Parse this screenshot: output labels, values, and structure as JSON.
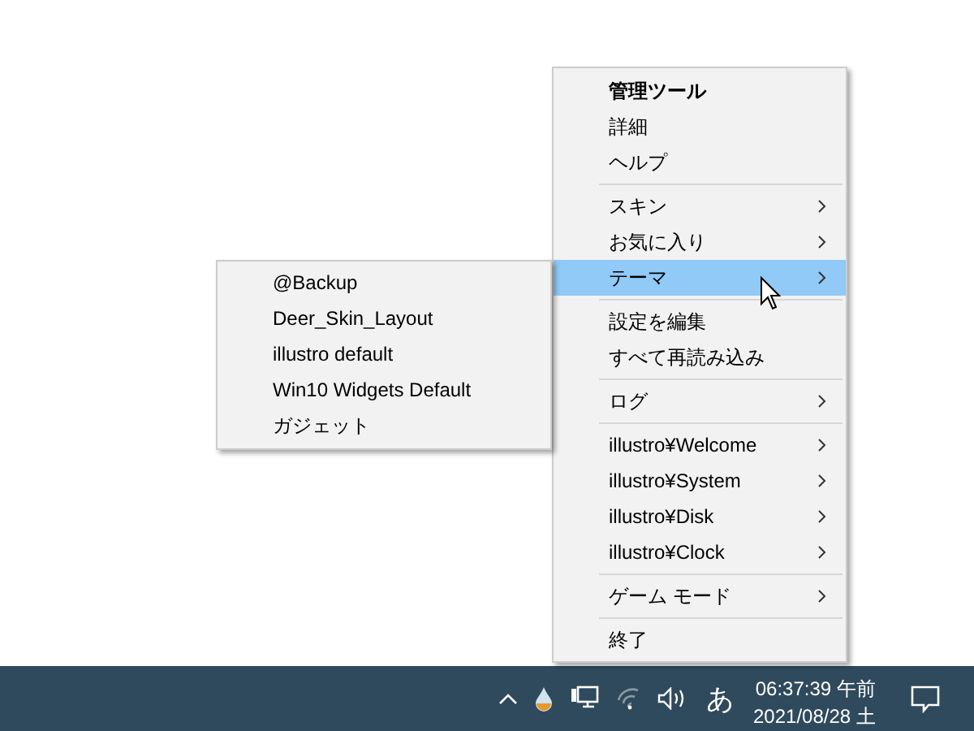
{
  "context_menu": {
    "items": [
      {
        "kind": "item",
        "label": "管理ツール",
        "bold": true,
        "selected": false,
        "has_submenu": false
      },
      {
        "kind": "item",
        "label": "詳細",
        "bold": false,
        "selected": false,
        "has_submenu": false
      },
      {
        "kind": "item",
        "label": "ヘルプ",
        "bold": false,
        "selected": false,
        "has_submenu": false
      },
      {
        "kind": "separator"
      },
      {
        "kind": "item",
        "label": "スキン",
        "bold": false,
        "selected": false,
        "has_submenu": true
      },
      {
        "kind": "item",
        "label": "お気に入り",
        "bold": false,
        "selected": false,
        "has_submenu": true
      },
      {
        "kind": "item",
        "label": "テーマ",
        "bold": false,
        "selected": true,
        "has_submenu": true
      },
      {
        "kind": "separator"
      },
      {
        "kind": "item",
        "label": "設定を編集",
        "bold": false,
        "selected": false,
        "has_submenu": false
      },
      {
        "kind": "item",
        "label": "すべて再読み込み",
        "bold": false,
        "selected": false,
        "has_submenu": false
      },
      {
        "kind": "separator"
      },
      {
        "kind": "item",
        "label": "ログ",
        "bold": false,
        "selected": false,
        "has_submenu": true
      },
      {
        "kind": "separator"
      },
      {
        "kind": "item",
        "label": "illustro¥Welcome",
        "bold": false,
        "selected": false,
        "has_submenu": true
      },
      {
        "kind": "item",
        "label": "illustro¥System",
        "bold": false,
        "selected": false,
        "has_submenu": true
      },
      {
        "kind": "item",
        "label": "illustro¥Disk",
        "bold": false,
        "selected": false,
        "has_submenu": true
      },
      {
        "kind": "item",
        "label": "illustro¥Clock",
        "bold": false,
        "selected": false,
        "has_submenu": true
      },
      {
        "kind": "separator"
      },
      {
        "kind": "item",
        "label": "ゲーム モード",
        "bold": false,
        "selected": false,
        "has_submenu": true
      },
      {
        "kind": "separator"
      },
      {
        "kind": "item",
        "label": "終了",
        "bold": false,
        "selected": false,
        "has_submenu": false
      }
    ]
  },
  "submenu": {
    "items": [
      {
        "label": "@Backup",
        "selected": false
      },
      {
        "label": "Deer_Skin_Layout",
        "selected": false
      },
      {
        "label": "illustro default",
        "selected": false
      },
      {
        "label": "Win10 Widgets Default",
        "selected": false
      },
      {
        "label": "ガジェット",
        "selected": false
      }
    ]
  },
  "taskbar": {
    "ime": "あ",
    "time": "06:37:39 午前",
    "date": "2021/08/28 土"
  }
}
